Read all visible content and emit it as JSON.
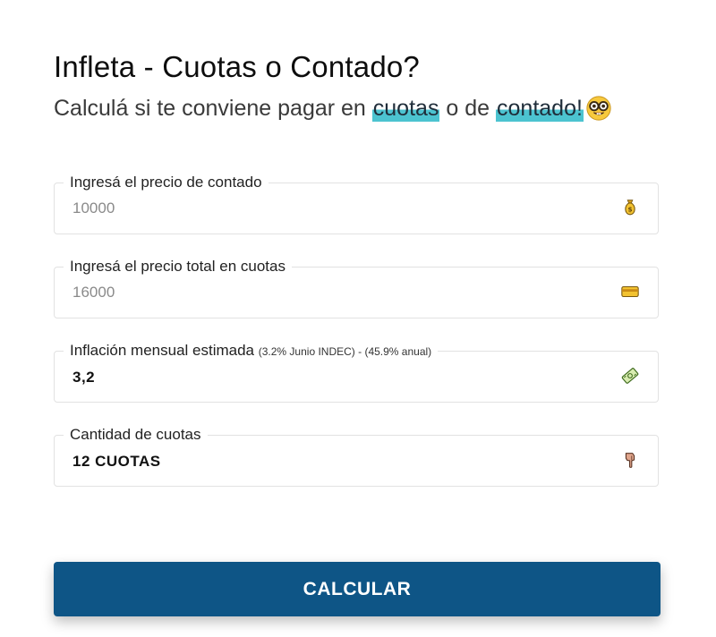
{
  "header": {
    "title": "Infleta - Cuotas o Contado?",
    "subtitle_prefix": "Calculá si te conviene pagar en ",
    "subtitle_word_1": "cuotas",
    "subtitle_middle": " o de ",
    "subtitle_word_2": "contado!",
    "subtitle_emoji": "nerd-face-icon",
    "highlight_color": "#4cc3d0"
  },
  "form": {
    "cash_price": {
      "label": "Ingresá el precio de contado",
      "placeholder": "10000",
      "icon": "money-bag-icon"
    },
    "installments_total": {
      "label": "Ingresá el precio total en cuotas",
      "placeholder": "16000",
      "icon": "credit-card-icon"
    },
    "inflation": {
      "label": "Inflación mensual estimada",
      "hint": "(3.2% Junio INDEC) - (45.9% anual)",
      "value": "3,2",
      "icon": "banknote-icon"
    },
    "installments_count": {
      "label": "Cantidad de cuotas",
      "value": "12 CUOTAS",
      "icon": "pointing-down-hand-icon"
    }
  },
  "actions": {
    "calculate_label": "CALCULAR",
    "button_color": "#0e5586"
  }
}
